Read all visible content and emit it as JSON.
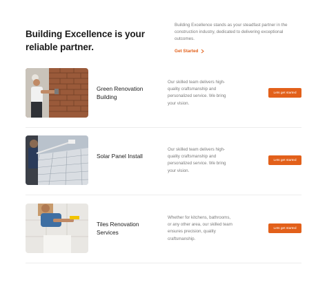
{
  "hero": {
    "headline": "Building Excellence is your reliable partner.",
    "intro": "Building Excellence stands as your steadfast partner in the construction industry, dedicated to delivering exceptional outcomes.",
    "get_started_label": "Get Started"
  },
  "services": [
    {
      "title": "Green Renovation Building",
      "description": "Our skilled team delivers high-quality craftsmanship and personalized service. We bring your vision.",
      "cta_label": "Lets get started"
    },
    {
      "title": "Solar Panel Install",
      "description": "Our skilled team delivers high-quality craftsmanship and personalized service. We bring your vision.",
      "cta_label": "Lets get started"
    },
    {
      "title": "Tiles Renovation Services",
      "description": "Whether for kitchens, bathrooms, or any other area, our skilled team ensures precision, quality craftsmanship.",
      "cta_label": "Lets get started"
    }
  ],
  "colors": {
    "accent": "#e2601a",
    "heading": "#1a1a1a",
    "body_text": "#7a7a7a",
    "divider": "#ececec"
  }
}
